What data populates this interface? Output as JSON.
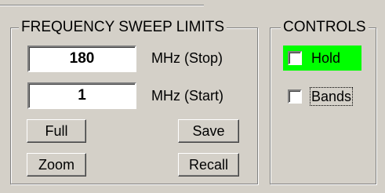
{
  "sweep": {
    "title": "FREQUENCY SWEEP LIMITS",
    "stop_value": "180",
    "stop_label": "MHz (Stop)",
    "start_value": "1",
    "start_label": "MHz (Start)",
    "buttons": {
      "full": "Full",
      "save": "Save",
      "zoom": "Zoom",
      "recall": "Recall"
    }
  },
  "controls": {
    "title": "CONTROLS",
    "hold_label": "Hold",
    "hold_checked": false,
    "hold_color": "#00ff00",
    "bands_label": "Bands",
    "bands_checked": false
  }
}
